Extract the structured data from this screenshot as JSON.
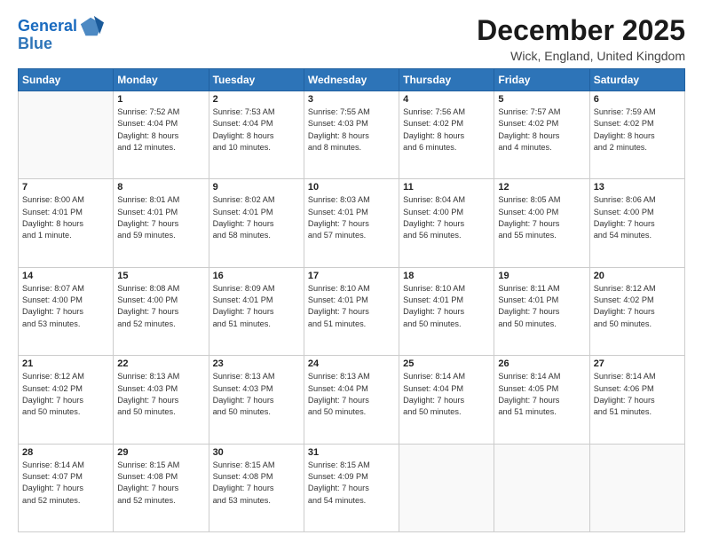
{
  "logo": {
    "line1": "General",
    "line2": "Blue"
  },
  "title": "December 2025",
  "location": "Wick, England, United Kingdom",
  "days_header": [
    "Sunday",
    "Monday",
    "Tuesday",
    "Wednesday",
    "Thursday",
    "Friday",
    "Saturday"
  ],
  "weeks": [
    [
      {
        "num": "",
        "info": ""
      },
      {
        "num": "1",
        "info": "Sunrise: 7:52 AM\nSunset: 4:04 PM\nDaylight: 8 hours\nand 12 minutes."
      },
      {
        "num": "2",
        "info": "Sunrise: 7:53 AM\nSunset: 4:04 PM\nDaylight: 8 hours\nand 10 minutes."
      },
      {
        "num": "3",
        "info": "Sunrise: 7:55 AM\nSunset: 4:03 PM\nDaylight: 8 hours\nand 8 minutes."
      },
      {
        "num": "4",
        "info": "Sunrise: 7:56 AM\nSunset: 4:02 PM\nDaylight: 8 hours\nand 6 minutes."
      },
      {
        "num": "5",
        "info": "Sunrise: 7:57 AM\nSunset: 4:02 PM\nDaylight: 8 hours\nand 4 minutes."
      },
      {
        "num": "6",
        "info": "Sunrise: 7:59 AM\nSunset: 4:02 PM\nDaylight: 8 hours\nand 2 minutes."
      }
    ],
    [
      {
        "num": "7",
        "info": "Sunrise: 8:00 AM\nSunset: 4:01 PM\nDaylight: 8 hours\nand 1 minute."
      },
      {
        "num": "8",
        "info": "Sunrise: 8:01 AM\nSunset: 4:01 PM\nDaylight: 7 hours\nand 59 minutes."
      },
      {
        "num": "9",
        "info": "Sunrise: 8:02 AM\nSunset: 4:01 PM\nDaylight: 7 hours\nand 58 minutes."
      },
      {
        "num": "10",
        "info": "Sunrise: 8:03 AM\nSunset: 4:01 PM\nDaylight: 7 hours\nand 57 minutes."
      },
      {
        "num": "11",
        "info": "Sunrise: 8:04 AM\nSunset: 4:00 PM\nDaylight: 7 hours\nand 56 minutes."
      },
      {
        "num": "12",
        "info": "Sunrise: 8:05 AM\nSunset: 4:00 PM\nDaylight: 7 hours\nand 55 minutes."
      },
      {
        "num": "13",
        "info": "Sunrise: 8:06 AM\nSunset: 4:00 PM\nDaylight: 7 hours\nand 54 minutes."
      }
    ],
    [
      {
        "num": "14",
        "info": "Sunrise: 8:07 AM\nSunset: 4:00 PM\nDaylight: 7 hours\nand 53 minutes."
      },
      {
        "num": "15",
        "info": "Sunrise: 8:08 AM\nSunset: 4:00 PM\nDaylight: 7 hours\nand 52 minutes."
      },
      {
        "num": "16",
        "info": "Sunrise: 8:09 AM\nSunset: 4:01 PM\nDaylight: 7 hours\nand 51 minutes."
      },
      {
        "num": "17",
        "info": "Sunrise: 8:10 AM\nSunset: 4:01 PM\nDaylight: 7 hours\nand 51 minutes."
      },
      {
        "num": "18",
        "info": "Sunrise: 8:10 AM\nSunset: 4:01 PM\nDaylight: 7 hours\nand 50 minutes."
      },
      {
        "num": "19",
        "info": "Sunrise: 8:11 AM\nSunset: 4:01 PM\nDaylight: 7 hours\nand 50 minutes."
      },
      {
        "num": "20",
        "info": "Sunrise: 8:12 AM\nSunset: 4:02 PM\nDaylight: 7 hours\nand 50 minutes."
      }
    ],
    [
      {
        "num": "21",
        "info": "Sunrise: 8:12 AM\nSunset: 4:02 PM\nDaylight: 7 hours\nand 50 minutes."
      },
      {
        "num": "22",
        "info": "Sunrise: 8:13 AM\nSunset: 4:03 PM\nDaylight: 7 hours\nand 50 minutes."
      },
      {
        "num": "23",
        "info": "Sunrise: 8:13 AM\nSunset: 4:03 PM\nDaylight: 7 hours\nand 50 minutes."
      },
      {
        "num": "24",
        "info": "Sunrise: 8:13 AM\nSunset: 4:04 PM\nDaylight: 7 hours\nand 50 minutes."
      },
      {
        "num": "25",
        "info": "Sunrise: 8:14 AM\nSunset: 4:04 PM\nDaylight: 7 hours\nand 50 minutes."
      },
      {
        "num": "26",
        "info": "Sunrise: 8:14 AM\nSunset: 4:05 PM\nDaylight: 7 hours\nand 51 minutes."
      },
      {
        "num": "27",
        "info": "Sunrise: 8:14 AM\nSunset: 4:06 PM\nDaylight: 7 hours\nand 51 minutes."
      }
    ],
    [
      {
        "num": "28",
        "info": "Sunrise: 8:14 AM\nSunset: 4:07 PM\nDaylight: 7 hours\nand 52 minutes."
      },
      {
        "num": "29",
        "info": "Sunrise: 8:15 AM\nSunset: 4:08 PM\nDaylight: 7 hours\nand 52 minutes."
      },
      {
        "num": "30",
        "info": "Sunrise: 8:15 AM\nSunset: 4:08 PM\nDaylight: 7 hours\nand 53 minutes."
      },
      {
        "num": "31",
        "info": "Sunrise: 8:15 AM\nSunset: 4:09 PM\nDaylight: 7 hours\nand 54 minutes."
      },
      {
        "num": "",
        "info": ""
      },
      {
        "num": "",
        "info": ""
      },
      {
        "num": "",
        "info": ""
      }
    ]
  ]
}
